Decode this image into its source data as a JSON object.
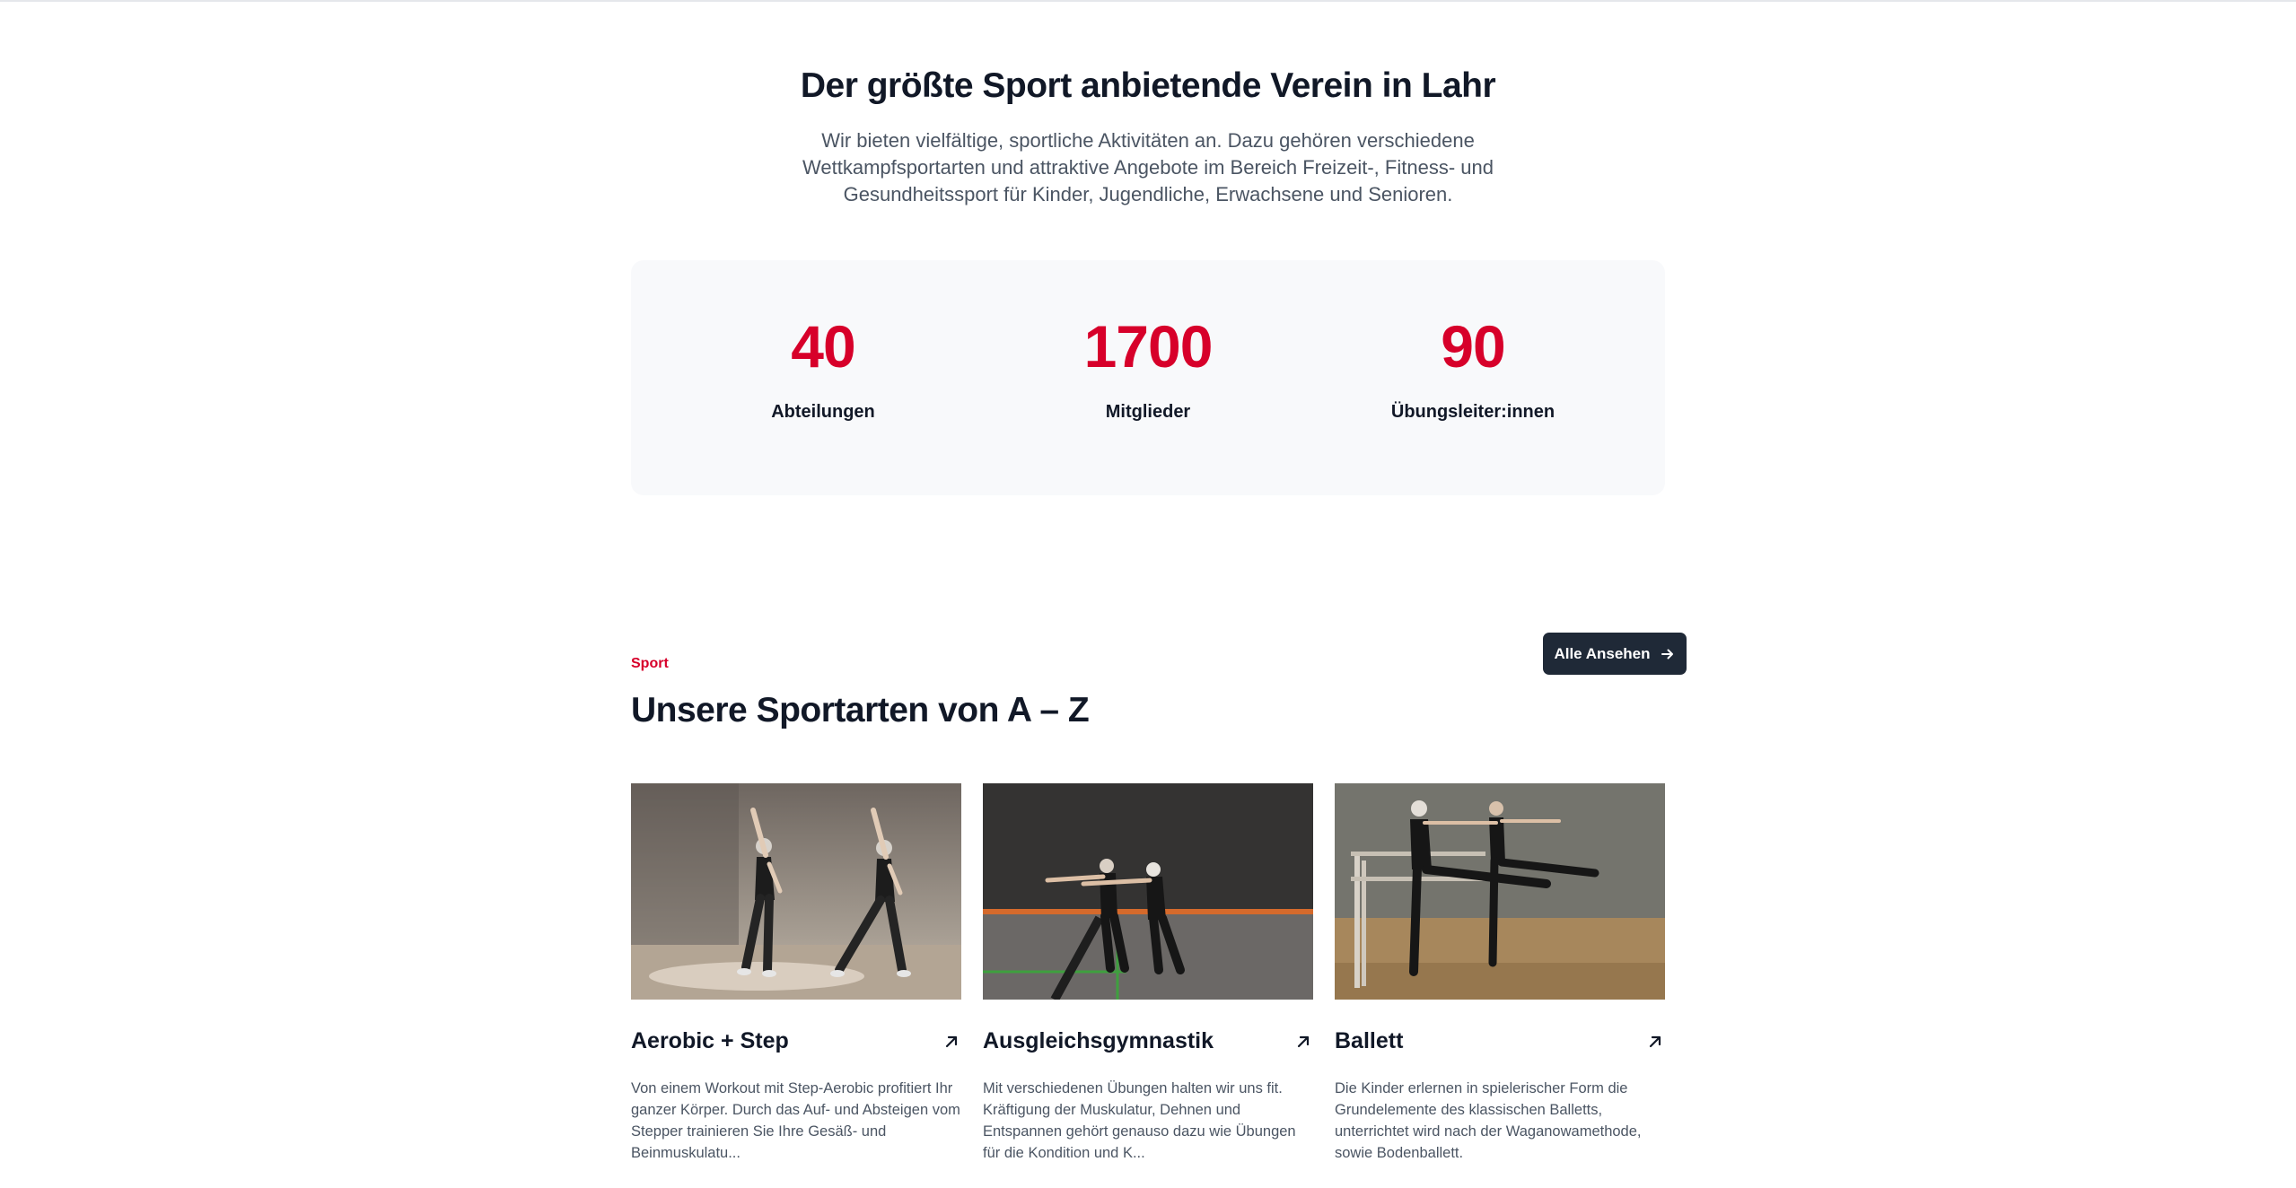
{
  "hero": {
    "title": "Der größte Sport anbietende Verein in Lahr",
    "description": "Wir bieten vielfältige, sportliche Aktivitäten an. Dazu gehören verschiedene Wettkampfsportarten und attraktive Angebote im Bereich Freizeit-, Fitness- und Gesundheitssport für Kinder, Jugendliche, Erwachsene und Senioren."
  },
  "stats": [
    {
      "value": "40",
      "label": "Abteilungen"
    },
    {
      "value": "1700",
      "label": "Mitglieder"
    },
    {
      "value": "90",
      "label": "Übungsleiter:innen"
    }
  ],
  "sports": {
    "kicker": "Sport",
    "title": "Unsere Sportarten von A – Z",
    "view_all_label": "Alle Ansehen",
    "cards": [
      {
        "title": "Aerobic + Step",
        "text": "Von einem Workout mit Step-Aerobic profitiert Ihr ganzer Körper. Durch das Auf- und Absteigen vom Stepper trainieren Sie Ihre Gesäß- und Beinmuskulatu..."
      },
      {
        "title": "Ausgleichsgymnastik",
        "text": "Mit verschiedenen Übungen halten wir uns fit. Kräftigung der Muskulatur, Dehnen und Entspannen gehört genauso dazu wie Übungen für die Kondition und K..."
      },
      {
        "title": "Ballett",
        "text": "Die Kinder erlernen in spielerischer Form die Grundelemente des klassischen Balletts, unterrichtet wird nach der Waganowamethode, sowie Bodenballett."
      }
    ]
  },
  "colors": {
    "accent": "#d7002a",
    "button_bg": "#1f2937",
    "stats_bg": "#f8f9fb"
  },
  "icons": {
    "button": "arrow-right-icon",
    "card": "arrow-up-right-icon"
  }
}
